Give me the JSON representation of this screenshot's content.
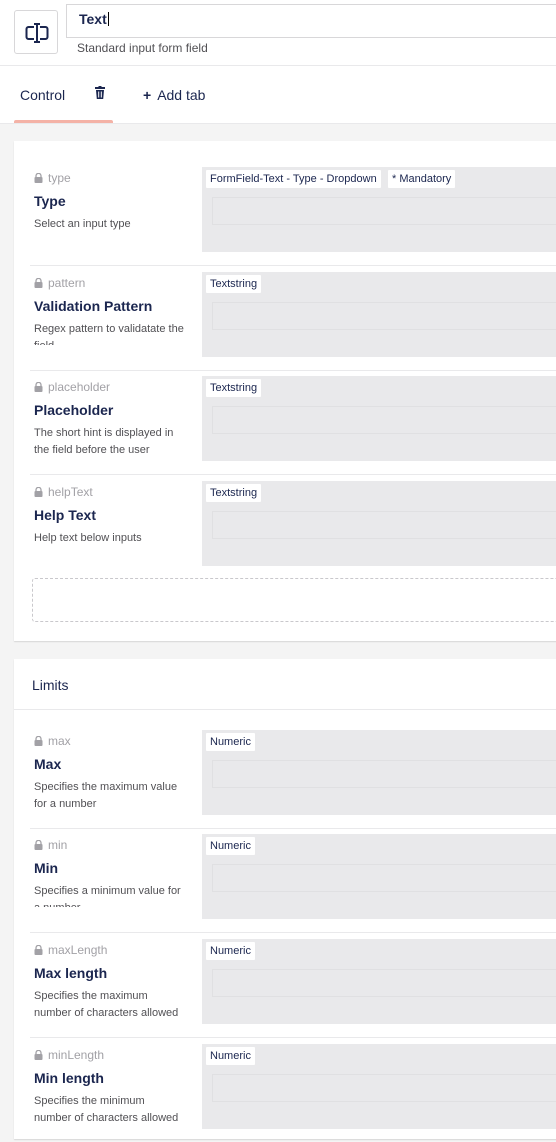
{
  "header": {
    "name_value": "Text",
    "description": "Standard input form field"
  },
  "tabs": {
    "control_label": "Control",
    "add_tab_label": "Add tab",
    "active_indicator_color": "#f4b2a6"
  },
  "control_group": {
    "properties": [
      {
        "alias": "type",
        "label": "Type",
        "description": "Select an input type",
        "editor": "FormField-Text - Type - Dropdown",
        "mandatory": "* Mandatory"
      },
      {
        "alias": "pattern",
        "label": "Validation Pattern",
        "description": "Regex pattern to validatate the field",
        "editor": "Textstring"
      },
      {
        "alias": "placeholder",
        "label": "Placeholder",
        "description": "The short hint is displayed in the field before the user",
        "editor": "Textstring"
      },
      {
        "alias": "helpText",
        "label": "Help Text",
        "description": "Help text below inputs",
        "editor": "Textstring"
      }
    ]
  },
  "limits_group": {
    "title": "Limits",
    "properties": [
      {
        "alias": "max",
        "label": "Max",
        "description": "Specifies the maximum value for a number",
        "editor": "Numeric"
      },
      {
        "alias": "min",
        "label": "Min",
        "description": "Specifies a minimum value for a number",
        "editor": "Numeric"
      },
      {
        "alias": "maxLength",
        "label": "Max length",
        "description": "Specifies the maximum number of characters allowed",
        "editor": "Numeric"
      },
      {
        "alias": "minLength",
        "label": "Min length",
        "description": "Specifies the minimum number of characters allowed",
        "editor": "Numeric"
      }
    ]
  },
  "icons": {
    "doc_type": "text-cursor-input-icon",
    "tab_delete": "trash-icon",
    "property_lock": "lock-icon",
    "add": "plus-icon"
  }
}
